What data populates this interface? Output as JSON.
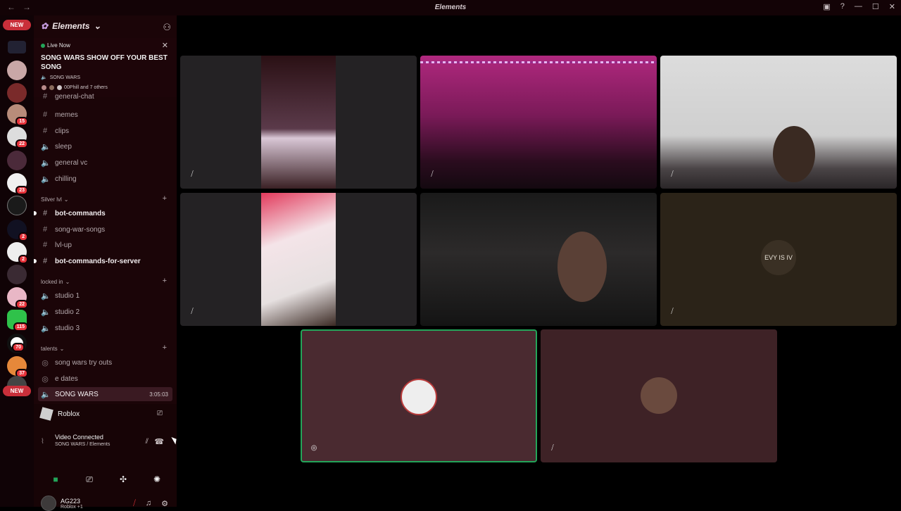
{
  "window": {
    "title": "Elements",
    "back": "←",
    "forward": "→"
  },
  "servers": {
    "new_top": "NEW",
    "new_bottom": "NEW",
    "badges": [
      "15",
      "22",
      "23",
      "2",
      "2",
      "22",
      "115",
      "70",
      "37"
    ]
  },
  "guild": {
    "name": "Elements"
  },
  "live": {
    "status": "Live Now",
    "title": "SONG WARS SHOW OFF YOUR BEST SONG",
    "channel": "SONG WARS",
    "participants": "00Phill and 7 others"
  },
  "channels": {
    "top": [
      {
        "name": "general-chat",
        "type": "text"
      },
      {
        "name": "memes",
        "type": "text"
      },
      {
        "name": "clips",
        "type": "text"
      },
      {
        "name": "sleep",
        "type": "voice"
      },
      {
        "name": "general vc",
        "type": "voice"
      },
      {
        "name": "chilling",
        "type": "voice"
      }
    ],
    "silver_category": "Silver lvl",
    "silver": [
      {
        "name": "bot-commands",
        "type": "text",
        "bold": true
      },
      {
        "name": "song-war-songs",
        "type": "text"
      },
      {
        "name": "lvl-up",
        "type": "text"
      },
      {
        "name": "bot-commands-for-server",
        "type": "text",
        "bold": true
      }
    ],
    "locked_category": "locked in",
    "locked": [
      {
        "name": "studio 1",
        "type": "voice"
      },
      {
        "name": "studio 2",
        "type": "voice"
      },
      {
        "name": "studio 3",
        "type": "voice"
      }
    ],
    "talents_category": "talents",
    "talents": [
      {
        "name": "song wars try outs",
        "type": "stage"
      },
      {
        "name": "e dates",
        "type": "stage"
      },
      {
        "name": "SONG WARS",
        "type": "voice",
        "time": "3:05:03"
      }
    ]
  },
  "activity": {
    "name": "Roblox"
  },
  "voice": {
    "status": "Video Connected",
    "location": "SONG WARS / Elements"
  },
  "user": {
    "name": "AG223",
    "status": "Roblox +1"
  },
  "tiles": {
    "tile6_text": "EVY IS IV"
  },
  "colors": {
    "accent_green": "#23a559",
    "badge_red": "#e7333b",
    "tile_bg": "#4a2a30"
  }
}
